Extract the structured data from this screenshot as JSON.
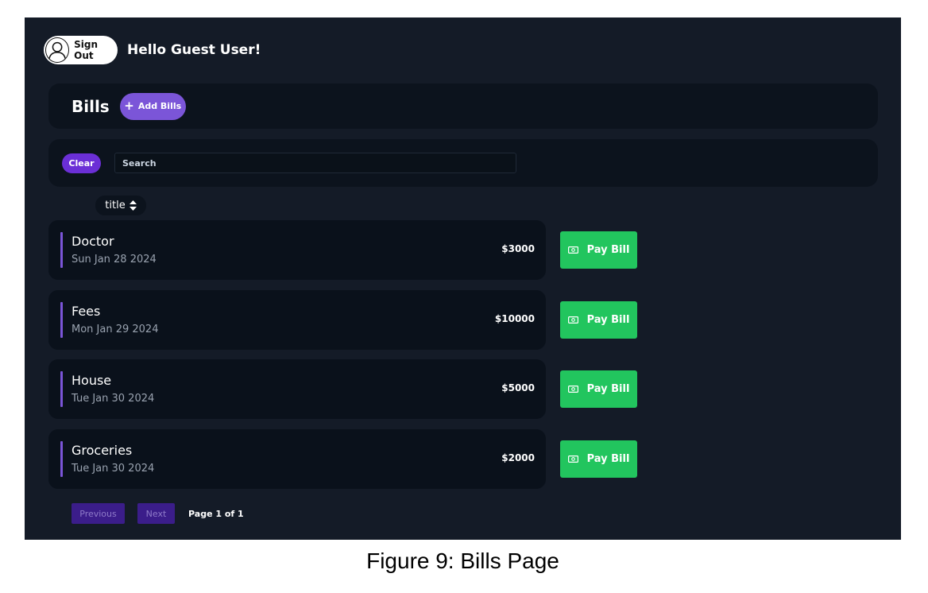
{
  "user": {
    "signout_label": "Sign Out",
    "greeting": "Hello Guest User!"
  },
  "header": {
    "title": "Bills",
    "add_label": "Add Bills"
  },
  "search": {
    "clear_label": "Clear",
    "placeholder": "Search"
  },
  "sort": {
    "label": "title"
  },
  "bills": [
    {
      "title": "Doctor",
      "date": "Sun Jan 28 2024",
      "amount": "$3000",
      "action": "Pay Bill"
    },
    {
      "title": "Fees",
      "date": "Mon Jan 29 2024",
      "amount": "$10000",
      "action": "Pay Bill"
    },
    {
      "title": "House",
      "date": "Tue Jan 30 2024",
      "amount": "$5000",
      "action": "Pay Bill"
    },
    {
      "title": "Groceries",
      "date": "Tue Jan 30 2024",
      "amount": "$2000",
      "action": "Pay Bill"
    }
  ],
  "pagination": {
    "previous_label": "Previous",
    "next_label": "Next",
    "page_label": "Page 1 of 1"
  },
  "caption": "Figure 9: Bills Page",
  "colors": {
    "background": "#141b27",
    "panel": "#0c131d",
    "accent": "#7b55d8",
    "pay": "#22c55e",
    "clear": "#6b2fd6"
  }
}
